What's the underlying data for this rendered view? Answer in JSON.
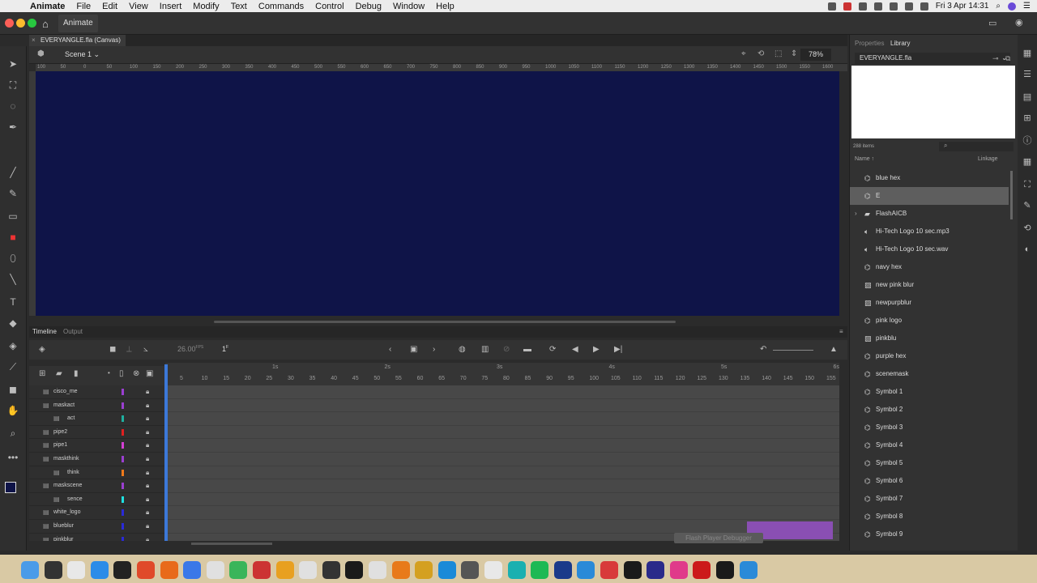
{
  "menubar": {
    "app": "Animate",
    "items": [
      "File",
      "Edit",
      "View",
      "Insert",
      "Modify",
      "Text",
      "Commands",
      "Control",
      "Debug",
      "Window",
      "Help"
    ],
    "clock": "Fri 3 Apr  14:31"
  },
  "app": {
    "name": "Animate"
  },
  "document": {
    "tab": "EVERYANGLE.fla (Canvas)",
    "close_glyph": "×"
  },
  "editbar": {
    "scene": "Scene 1",
    "zoom": "78%"
  },
  "ruler_ticks": [
    "100",
    "50",
    "0",
    "50",
    "100",
    "150",
    "200",
    "250",
    "300",
    "350",
    "400",
    "450",
    "500",
    "550",
    "600",
    "650",
    "700",
    "750",
    "800",
    "850",
    "900",
    "950",
    "1000",
    "1050",
    "1100",
    "1150",
    "1200",
    "1250",
    "1300",
    "1350",
    "1400",
    "1450",
    "1500",
    "1550",
    "1600"
  ],
  "stage": {
    "color": "#0f1448"
  },
  "timeline": {
    "tab": "Timeline",
    "output_tab": "Output",
    "fps": "26.00",
    "fps_unit": "FPS",
    "frame": "1",
    "frame_unit": "F",
    "frame_numbers": [
      "5",
      "10",
      "15",
      "20",
      "25",
      "30",
      "35",
      "40",
      "45",
      "50",
      "55",
      "60",
      "65",
      "70",
      "75",
      "80",
      "85",
      "90",
      "95",
      "100",
      "105",
      "110",
      "115",
      "120",
      "125",
      "130",
      "135",
      "140",
      "145",
      "150",
      "155"
    ],
    "seconds": [
      "1s",
      "2s",
      "3s",
      "4s",
      "5s",
      "6s"
    ],
    "layers": [
      {
        "name": "cisco_me",
        "color": "#9b3fd1",
        "indent": 0
      },
      {
        "name": "maskact",
        "color": "#9b3fd1",
        "indent": 0
      },
      {
        "name": "act",
        "color": "#1fb0a0",
        "indent": 1
      },
      {
        "name": "pipe2",
        "color": "#e02020",
        "indent": 0
      },
      {
        "name": "pipe1",
        "color": "#d43fd4",
        "indent": 0
      },
      {
        "name": "maskthink",
        "color": "#9b3fd1",
        "indent": 0
      },
      {
        "name": "think",
        "color": "#f07a1a",
        "indent": 1
      },
      {
        "name": "maskscene",
        "color": "#9b3fd1",
        "indent": 0
      },
      {
        "name": "sence",
        "color": "#1fe0e0",
        "indent": 1
      },
      {
        "name": "white_logo",
        "color": "#2a2ad8",
        "indent": 0
      },
      {
        "name": "blueblur",
        "color": "#2a2ad8",
        "indent": 0
      },
      {
        "name": "pinkblur",
        "color": "#2a2ad8",
        "indent": 0
      }
    ],
    "debugger_label": "Flash Player Debugger"
  },
  "library": {
    "tab_properties": "Properties",
    "tab_library": "Library",
    "document": "EVERYANGLE.fla",
    "count": "288 items",
    "col_name": "Name",
    "col_linkage": "Linkage",
    "items": [
      {
        "name": "blue hex",
        "icon": "symbol-icon",
        "selected": false,
        "folder": false
      },
      {
        "name": "E",
        "icon": "symbol-icon",
        "selected": true,
        "folder": false
      },
      {
        "name": "FlashAICB",
        "icon": "folder-icon",
        "selected": false,
        "folder": true
      },
      {
        "name": "Hi-Tech Logo 10 sec.mp3",
        "icon": "sound-icon",
        "selected": false,
        "folder": false
      },
      {
        "name": "Hi-Tech Logo 10 sec.wav",
        "icon": "sound-icon",
        "selected": false,
        "folder": false
      },
      {
        "name": "navy hex",
        "icon": "symbol-icon",
        "selected": false,
        "folder": false
      },
      {
        "name": "new pink blur",
        "icon": "bitmap-icon",
        "selected": false,
        "folder": false
      },
      {
        "name": "newpurpblur",
        "icon": "bitmap-icon",
        "selected": false,
        "folder": false
      },
      {
        "name": "pink logo",
        "icon": "symbol-icon",
        "selected": false,
        "folder": false
      },
      {
        "name": "pinkblu",
        "icon": "bitmap-icon",
        "selected": false,
        "folder": false
      },
      {
        "name": "purple hex",
        "icon": "symbol-icon",
        "selected": false,
        "folder": false
      },
      {
        "name": "scenemask",
        "icon": "symbol-icon",
        "selected": false,
        "folder": false
      },
      {
        "name": "Symbol 1",
        "icon": "symbol-icon",
        "selected": false,
        "folder": false
      },
      {
        "name": "Symbol 2",
        "icon": "symbol-icon",
        "selected": false,
        "folder": false
      },
      {
        "name": "Symbol 3",
        "icon": "symbol-icon",
        "selected": false,
        "folder": false
      },
      {
        "name": "Symbol 4",
        "icon": "symbol-icon",
        "selected": false,
        "folder": false
      },
      {
        "name": "Symbol 5",
        "icon": "symbol-icon",
        "selected": false,
        "folder": false
      },
      {
        "name": "Symbol 6",
        "icon": "symbol-icon",
        "selected": false,
        "folder": false
      },
      {
        "name": "Symbol 7",
        "icon": "symbol-icon",
        "selected": false,
        "folder": false
      },
      {
        "name": "Symbol 8",
        "icon": "symbol-icon",
        "selected": false,
        "folder": false
      },
      {
        "name": "Symbol 9",
        "icon": "symbol-icon",
        "selected": false,
        "folder": false
      }
    ]
  },
  "dock": {
    "background": "#d9c9a4",
    "app_colors": [
      "#4a9be8",
      "#333333",
      "#e8e8e8",
      "#2c8ce8",
      "#222222",
      "#e04a2a",
      "#e86a1a",
      "#3a78e8",
      "#e0e0e0",
      "#3ab55a",
      "#cc3333",
      "#e8a020",
      "#e0e0e0",
      "#333333",
      "#1a1a1a",
      "#e0e0e0",
      "#e87a1a",
      "#d4a020",
      "#1a8ad8",
      "#555555",
      "#e8e8e8",
      "#1ab0b0",
      "#1db954",
      "#1a3a8a",
      "#2a8ad8",
      "#d83a3a",
      "#1a1a1a",
      "#2a2a8a",
      "#e03a8a",
      "#cc1a1a",
      "#1a1a1a",
      "#2a8ad8"
    ]
  }
}
